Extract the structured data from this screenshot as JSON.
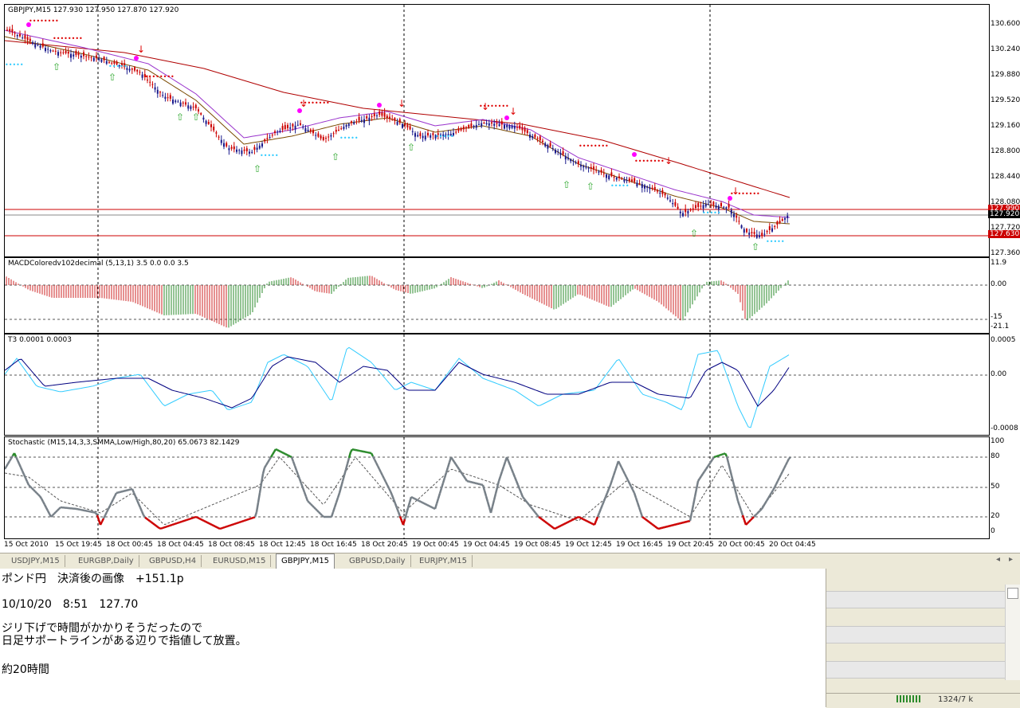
{
  "main_pane": {
    "label": "GBPJPY,M15  127.930 127.950 127.870 127.920",
    "yticks": [
      "130.600",
      "130.240",
      "129.880",
      "129.520",
      "129.160",
      "128.800",
      "128.440",
      "128.080",
      "127.720",
      "127.360"
    ],
    "price_label_current": "127.920",
    "price_label_line_top": "127.990",
    "price_label_line_bottom": "127.630",
    "colors": {
      "bull": "#1a1a8c",
      "bear": "#cc0000",
      "hline": "#cc0000",
      "ma_slow": "#b00000",
      "ma_fast": "#7a4a00",
      "cyan": "#33ccff",
      "magenta": "#ff00ff",
      "arrow_up": "#33aa33",
      "arrow_down": "#dd0000"
    }
  },
  "macd_pane": {
    "label": "MACDColoredv102decimal (5,13,1) 3.5 0.0 0.0 3.5",
    "yticks": [
      "11.9",
      "0.00",
      "-15",
      "-21.1"
    ]
  },
  "t3_pane": {
    "label": "T3 0.0001 0.0003",
    "yticks": [
      "0.0005",
      "0.00",
      "-0.0008"
    ]
  },
  "stoch_pane": {
    "label": "Stochastic (M15,14,3,3,SMMA,Low/High,80,20) 65.0673 82.1429",
    "yticks": [
      "100",
      "80",
      "50",
      "20",
      "0"
    ]
  },
  "xaxis": {
    "ticks": [
      "15 Oct 2010",
      "15 Oct 19:45",
      "18 Oct 00:45",
      "18 Oct 04:45",
      "18 Oct 08:45",
      "18 Oct 12:45",
      "18 Oct 16:45",
      "18 Oct 20:45",
      "19 Oct 00:45",
      "19 Oct 04:45",
      "19 Oct 08:45",
      "19 Oct 12:45",
      "19 Oct 16:45",
      "19 Oct 20:45",
      "20 Oct 00:45",
      "20 Oct 04:45"
    ]
  },
  "tabs": {
    "items": [
      "USDJPY,M15",
      "EURGBP,Daily",
      "GBPUSD,H4",
      "EURUSD,M15",
      "GBPJPY,M15",
      "GBPUSD,Daily",
      "EURJPY,M15"
    ],
    "active": "GBPJPY,M15",
    "nav_left": "◂",
    "nav_right": "▸"
  },
  "note": {
    "lines": [
      "ポンド円　決済後の画像　+151.1p",
      "10/10/20　8:51　127.70",
      "ジリ下げで時間がかかりそうだったので",
      "日足サポートラインがある辺りで指値して放置。",
      "約20時間"
    ]
  },
  "status_bar": {
    "text": "1324/7 k"
  }
}
